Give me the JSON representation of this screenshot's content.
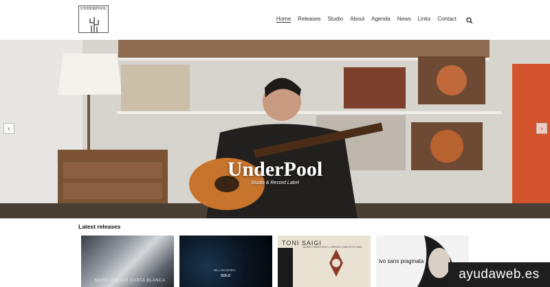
{
  "header": {
    "logo_text": "UNDERPOOL",
    "nav": [
      {
        "label": "Home",
        "active": true
      },
      {
        "label": "Releases"
      },
      {
        "label": "Studio"
      },
      {
        "label": "About"
      },
      {
        "label": "Agenda"
      },
      {
        "label": "News"
      },
      {
        "label": "Links"
      },
      {
        "label": "Contact"
      }
    ],
    "search_icon": "search-icon"
  },
  "hero": {
    "title": "UnderPool",
    "subtitle": "Studio & Record Label",
    "prev_icon": "chevron-left-icon",
    "next_icon": "chevron-right-icon"
  },
  "releases": {
    "title": "Latest releases",
    "items": [
      {
        "text": "MARC CUEVAS  CARTA BLANCA"
      },
      {
        "line1": "BILL McHENRY",
        "line2": "SOLO"
      },
      {
        "line1": "TONI SAIGI",
        "line2": "JAUME TORRES MAS • LORENZO CARLOS FILOMEL"
      },
      {
        "text": "ivo sans  pragmata"
      }
    ]
  },
  "watermark": "ayudaweb.es"
}
